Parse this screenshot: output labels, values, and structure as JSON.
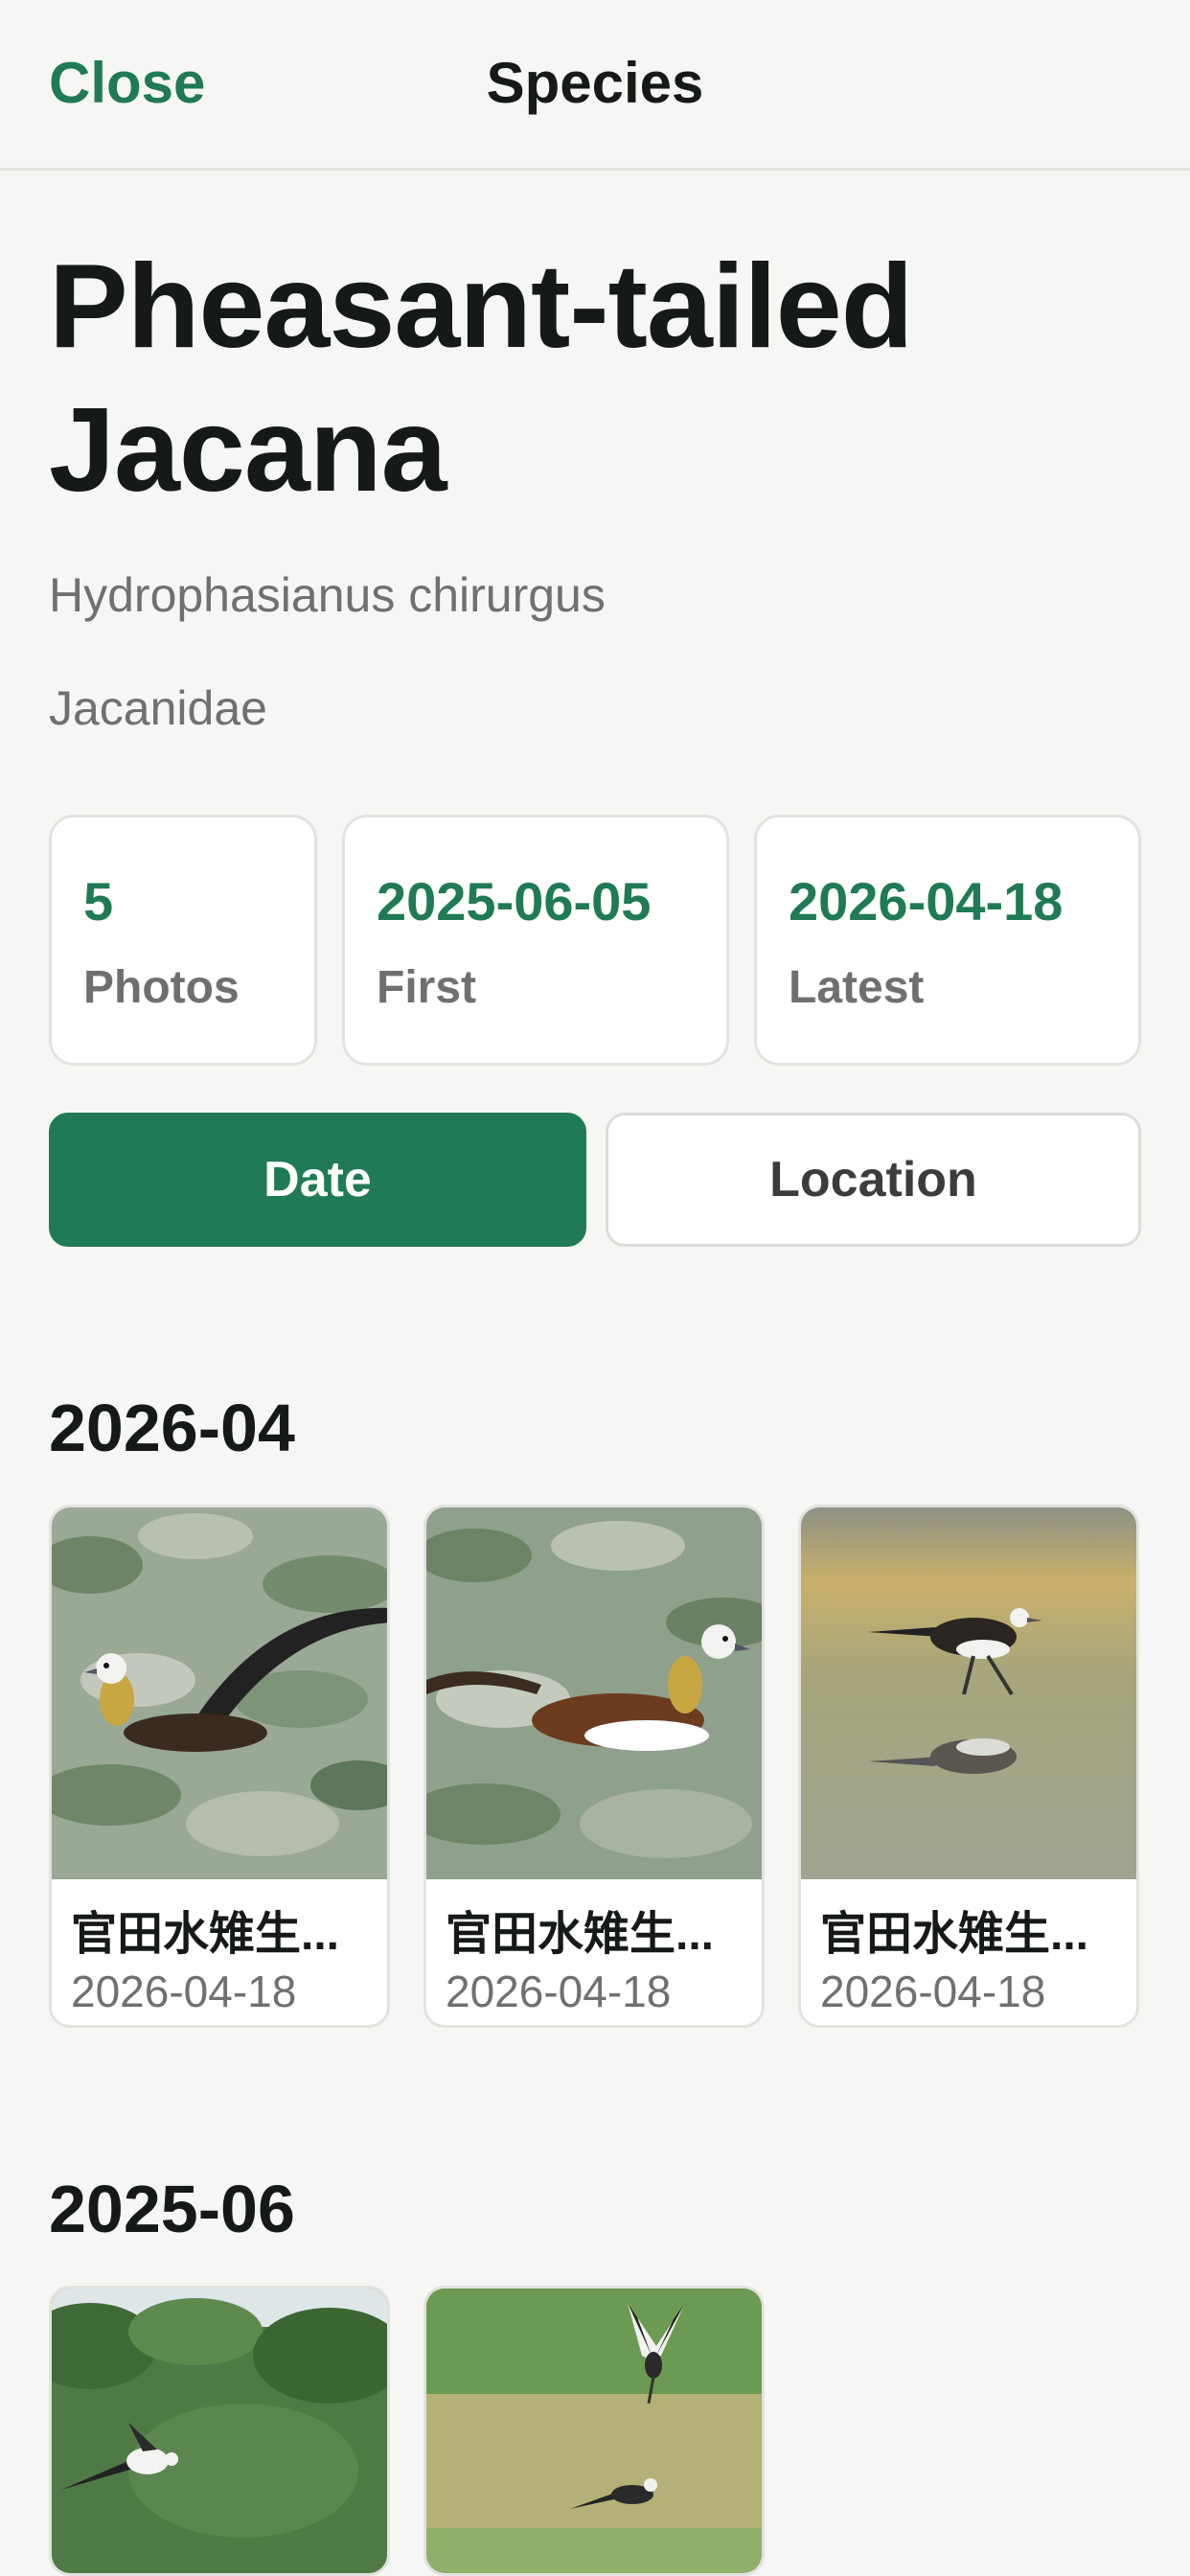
{
  "nav": {
    "close_label": "Close",
    "title": "Species"
  },
  "species": {
    "common_name": "Pheasant-tailed Jacana",
    "scientific_name": "Hydrophasianus chirurgus",
    "family": "Jacanidae"
  },
  "stats": {
    "photos": {
      "value": "5",
      "label": "Photos"
    },
    "first": {
      "value": "2025-06-05",
      "label": "First"
    },
    "latest": {
      "value": "2026-04-18",
      "label": "Latest"
    }
  },
  "segments": {
    "selected": "Date",
    "date_label": "Date",
    "location_label": "Location"
  },
  "sections": [
    {
      "title": "2026-04",
      "items": [
        {
          "caption": "官田水雉生...",
          "date": "2026-04-18"
        },
        {
          "caption": "官田水雉生...",
          "date": "2026-04-18"
        },
        {
          "caption": "官田水雉生...",
          "date": "2026-04-18"
        }
      ]
    },
    {
      "title": "2025-06",
      "items": [
        {
          "caption": "",
          "date": ""
        },
        {
          "caption": "",
          "date": ""
        }
      ]
    }
  ],
  "colors": {
    "accent": "#1f7a55",
    "background": "#f6f6f4",
    "card": "#ffffff",
    "muted_text": "#707070"
  }
}
